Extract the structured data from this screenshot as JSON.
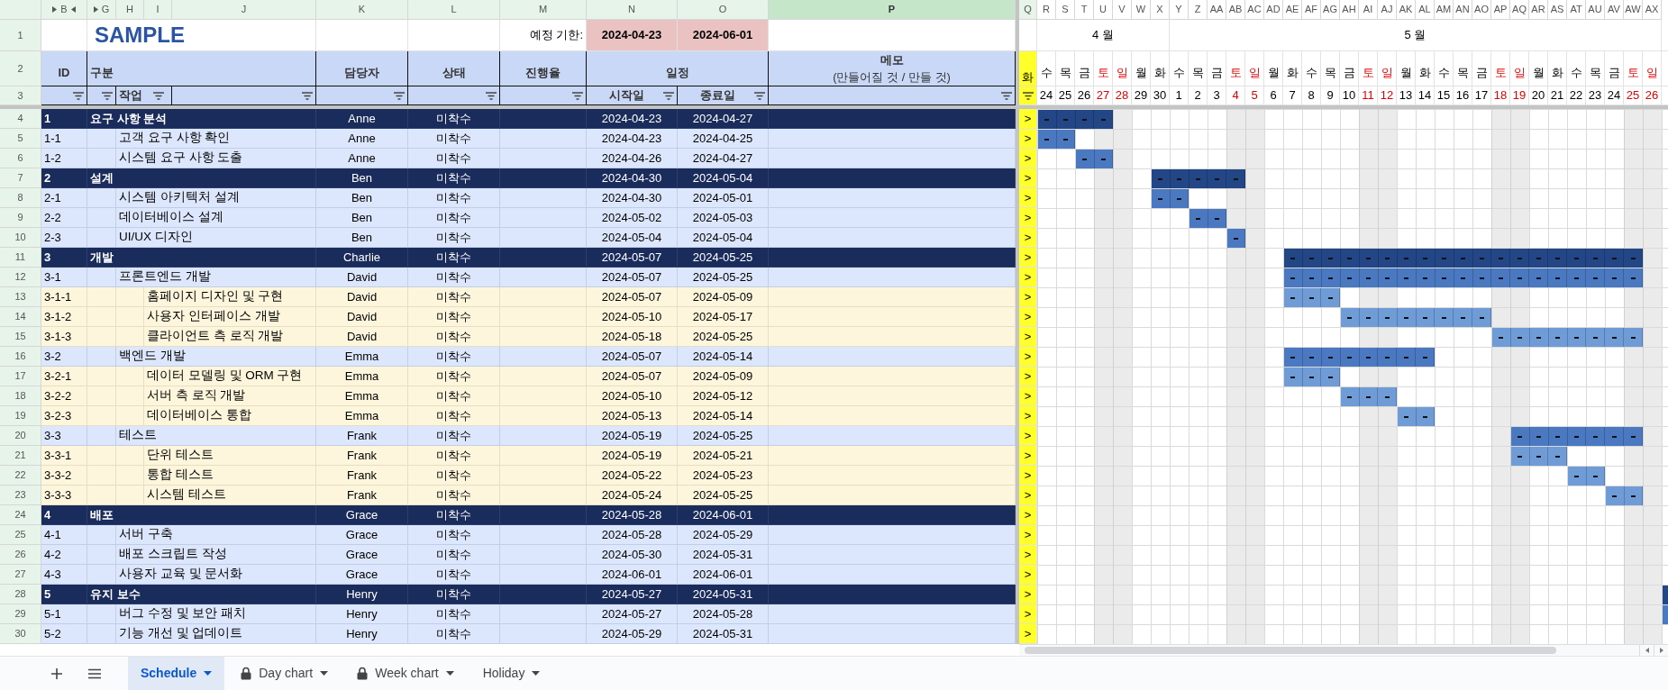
{
  "columns": [
    {
      "label": "B",
      "selected": true,
      "current": false,
      "hidden_before": true,
      "hidden_after": true
    },
    {
      "label": "G",
      "selected": true,
      "current": false,
      "hidden_before": true,
      "hidden_after": false
    },
    {
      "label": "H",
      "selected": true,
      "current": false,
      "hidden_before": false,
      "hidden_after": false
    },
    {
      "label": "I",
      "selected": true,
      "current": false,
      "hidden_before": false,
      "hidden_after": false
    },
    {
      "label": "J",
      "selected": true,
      "current": false,
      "hidden_before": false,
      "hidden_after": false
    },
    {
      "label": "K",
      "selected": true,
      "current": false,
      "hidden_before": false,
      "hidden_after": false
    },
    {
      "label": "L",
      "selected": true,
      "current": false,
      "hidden_before": false,
      "hidden_after": false
    },
    {
      "label": "M",
      "selected": true,
      "current": false,
      "hidden_before": false,
      "hidden_after": false
    },
    {
      "label": "N",
      "selected": true,
      "current": false,
      "hidden_before": false,
      "hidden_after": false
    },
    {
      "label": "O",
      "selected": true,
      "current": false,
      "hidden_before": false,
      "hidden_after": false
    },
    {
      "label": "P",
      "selected": true,
      "current": true,
      "hidden_before": false,
      "hidden_after": false
    },
    {
      "label": "Q",
      "selected": true,
      "current": false,
      "hidden_before": false,
      "hidden_after": false
    },
    {
      "label": "R",
      "selected": false,
      "current": false,
      "hidden_before": false,
      "hidden_after": false
    },
    {
      "label": "S",
      "selected": false,
      "current": false,
      "hidden_before": false,
      "hidden_after": false
    },
    {
      "label": "T",
      "selected": false,
      "current": false,
      "hidden_before": false,
      "hidden_after": false
    },
    {
      "label": "U",
      "selected": false,
      "current": false,
      "hidden_before": false,
      "hidden_after": false
    },
    {
      "label": "V",
      "selected": false,
      "current": false,
      "hidden_before": false,
      "hidden_after": false
    },
    {
      "label": "W",
      "selected": false,
      "current": false,
      "hidden_before": false,
      "hidden_after": false
    },
    {
      "label": "X",
      "selected": false,
      "current": false,
      "hidden_before": false,
      "hidden_after": false
    },
    {
      "label": "Y",
      "selected": false,
      "current": false,
      "hidden_before": false,
      "hidden_after": false
    },
    {
      "label": "Z",
      "selected": false,
      "current": false,
      "hidden_before": false,
      "hidden_after": false
    },
    {
      "label": "AA",
      "selected": false,
      "current": false,
      "hidden_before": false,
      "hidden_after": false
    },
    {
      "label": "AB",
      "selected": false,
      "current": false,
      "hidden_before": false,
      "hidden_after": false
    },
    {
      "label": "AC",
      "selected": false,
      "current": false,
      "hidden_before": false,
      "hidden_after": false
    },
    {
      "label": "AD",
      "selected": false,
      "current": false,
      "hidden_before": false,
      "hidden_after": false
    },
    {
      "label": "AE",
      "selected": false,
      "current": false,
      "hidden_before": false,
      "hidden_after": false
    },
    {
      "label": "AF",
      "selected": false,
      "current": false,
      "hidden_before": false,
      "hidden_after": false
    },
    {
      "label": "AG",
      "selected": false,
      "current": false,
      "hidden_before": false,
      "hidden_after": false
    },
    {
      "label": "AH",
      "selected": false,
      "current": false,
      "hidden_before": false,
      "hidden_after": false
    },
    {
      "label": "AI",
      "selected": false,
      "current": false,
      "hidden_before": false,
      "hidden_after": false
    },
    {
      "label": "AJ",
      "selected": false,
      "current": false,
      "hidden_before": false,
      "hidden_after": false
    },
    {
      "label": "AK",
      "selected": false,
      "current": false,
      "hidden_before": false,
      "hidden_after": false
    },
    {
      "label": "AL",
      "selected": false,
      "current": false,
      "hidden_before": false,
      "hidden_after": false
    },
    {
      "label": "AM",
      "selected": false,
      "current": false,
      "hidden_before": false,
      "hidden_after": false
    },
    {
      "label": "AN",
      "selected": false,
      "current": false,
      "hidden_before": false,
      "hidden_after": false
    },
    {
      "label": "AO",
      "selected": false,
      "current": false,
      "hidden_before": false,
      "hidden_after": false
    },
    {
      "label": "AP",
      "selected": false,
      "current": false,
      "hidden_before": false,
      "hidden_after": false
    },
    {
      "label": "AQ",
      "selected": false,
      "current": false,
      "hidden_before": false,
      "hidden_after": false
    },
    {
      "label": "AR",
      "selected": false,
      "current": false,
      "hidden_before": false,
      "hidden_after": false
    },
    {
      "label": "AS",
      "selected": false,
      "current": false,
      "hidden_before": false,
      "hidden_after": false
    },
    {
      "label": "AT",
      "selected": false,
      "current": false,
      "hidden_before": false,
      "hidden_after": false
    },
    {
      "label": "AU",
      "selected": false,
      "current": false,
      "hidden_before": false,
      "hidden_after": false
    },
    {
      "label": "AV",
      "selected": false,
      "current": false,
      "hidden_before": false,
      "hidden_after": false
    },
    {
      "label": "AW",
      "selected": false,
      "current": false,
      "hidden_before": false,
      "hidden_after": false
    },
    {
      "label": "AX",
      "selected": false,
      "current": false,
      "hidden_before": false,
      "hidden_after": false
    }
  ],
  "row_labels": [
    "1",
    "2",
    "3",
    "4",
    "5",
    "6",
    "7",
    "8",
    "9",
    "10",
    "11",
    "12",
    "13",
    "14",
    "15",
    "16",
    "17",
    "18",
    "19",
    "20",
    "21",
    "22",
    "23",
    "24",
    "25",
    "26",
    "27",
    "28",
    "29",
    "30"
  ],
  "title": "SAMPLE",
  "deadline": {
    "label": "예정 기한:",
    "start": "2024-04-23",
    "end": "2024-06-01"
  },
  "header": {
    "id": "ID",
    "group": "구분",
    "task": "작업",
    "assignee": "담당자",
    "status": "상태",
    "progress": "진행율",
    "schedule": "일정",
    "start": "시작일",
    "end": "종료일",
    "memo": "메모",
    "memo_note": "(만들어질 것 / 만들 것)"
  },
  "today": {
    "weekday": "화"
  },
  "months": [
    {
      "label": "4 월",
      "days": [
        {
          "weekday": "수",
          "date": "24",
          "weekend": false
        },
        {
          "weekday": "목",
          "date": "25",
          "weekend": false
        },
        {
          "weekday": "금",
          "date": "26",
          "weekend": false
        },
        {
          "weekday": "토",
          "date": "27",
          "weekend": true
        },
        {
          "weekday": "일",
          "date": "28",
          "weekend": true
        },
        {
          "weekday": "월",
          "date": "29",
          "weekend": false
        },
        {
          "weekday": "화",
          "date": "30",
          "weekend": false
        }
      ]
    },
    {
      "label": "5 월",
      "days": [
        {
          "weekday": "수",
          "date": "1",
          "weekend": false
        },
        {
          "weekday": "목",
          "date": "2",
          "weekend": false
        },
        {
          "weekday": "금",
          "date": "3",
          "weekend": false
        },
        {
          "weekday": "토",
          "date": "4",
          "weekend": true
        },
        {
          "weekday": "일",
          "date": "5",
          "weekend": true
        },
        {
          "weekday": "월",
          "date": "6",
          "weekend": false
        },
        {
          "weekday": "화",
          "date": "7",
          "weekend": false
        },
        {
          "weekday": "수",
          "date": "8",
          "weekend": false
        },
        {
          "weekday": "목",
          "date": "9",
          "weekend": false
        },
        {
          "weekday": "금",
          "date": "10",
          "weekend": false
        },
        {
          "weekday": "토",
          "date": "11",
          "weekend": true
        },
        {
          "weekday": "일",
          "date": "12",
          "weekend": true
        },
        {
          "weekday": "월",
          "date": "13",
          "weekend": false
        },
        {
          "weekday": "화",
          "date": "14",
          "weekend": false
        },
        {
          "weekday": "수",
          "date": "15",
          "weekend": false
        },
        {
          "weekday": "목",
          "date": "16",
          "weekend": false
        },
        {
          "weekday": "금",
          "date": "17",
          "weekend": false
        },
        {
          "weekday": "토",
          "date": "18",
          "weekend": true
        },
        {
          "weekday": "일",
          "date": "19",
          "weekend": true
        },
        {
          "weekday": "월",
          "date": "20",
          "weekend": false
        },
        {
          "weekday": "화",
          "date": "21",
          "weekend": false
        },
        {
          "weekday": "수",
          "date": "22",
          "weekend": false
        },
        {
          "weekday": "목",
          "date": "23",
          "weekend": false
        },
        {
          "weekday": "금",
          "date": "24",
          "weekend": false
        },
        {
          "weekday": "토",
          "date": "25",
          "weekend": true
        },
        {
          "weekday": "일",
          "date": "26",
          "weekend": true
        }
      ]
    }
  ],
  "rows": [
    {
      "kind": "phase",
      "id": "1",
      "task": "요구 사항 분석",
      "assignee": "Anne",
      "status": "미착수",
      "start": "2024-04-23",
      "end": "2024-04-27",
      "marker": ">"
    },
    {
      "kind": "task",
      "id": "1-1",
      "task": "고객 요구 사항 확인",
      "assignee": "Anne",
      "status": "미착수",
      "start": "2024-04-23",
      "end": "2024-04-25",
      "marker": ">"
    },
    {
      "kind": "task",
      "id": "1-2",
      "task": "시스템 요구 사항 도출",
      "assignee": "Anne",
      "status": "미착수",
      "start": "2024-04-26",
      "end": "2024-04-27",
      "marker": ">"
    },
    {
      "kind": "phase",
      "id": "2",
      "task": "설계",
      "assignee": "Ben",
      "status": "미착수",
      "start": "2024-04-30",
      "end": "2024-05-04",
      "marker": ">"
    },
    {
      "kind": "task",
      "id": "2-1",
      "task": "시스템 아키텍처 설계",
      "assignee": "Ben",
      "status": "미착수",
      "start": "2024-04-30",
      "end": "2024-05-01",
      "marker": ">"
    },
    {
      "kind": "task",
      "id": "2-2",
      "task": "데이터베이스 설계",
      "assignee": "Ben",
      "status": "미착수",
      "start": "2024-05-02",
      "end": "2024-05-03",
      "marker": ">"
    },
    {
      "kind": "task",
      "id": "2-3",
      "task": "UI/UX 디자인",
      "assignee": "Ben",
      "status": "미착수",
      "start": "2024-05-04",
      "end": "2024-05-04",
      "marker": ">"
    },
    {
      "kind": "phase",
      "id": "3",
      "task": "개발",
      "assignee": "Charlie",
      "status": "미착수",
      "start": "2024-05-07",
      "end": "2024-05-25",
      "marker": ">"
    },
    {
      "kind": "task",
      "id": "3-1",
      "task": "프론트엔드 개발",
      "assignee": "David",
      "status": "미착수",
      "start": "2024-05-07",
      "end": "2024-05-25",
      "marker": ">"
    },
    {
      "kind": "subtask",
      "id": "3-1-1",
      "task": "홈페이지 디자인 및 구현",
      "assignee": "David",
      "status": "미착수",
      "start": "2024-05-07",
      "end": "2024-05-09",
      "marker": ">"
    },
    {
      "kind": "subtask",
      "id": "3-1-2",
      "task": "사용자 인터페이스 개발",
      "assignee": "David",
      "status": "미착수",
      "start": "2024-05-10",
      "end": "2024-05-17",
      "marker": ">"
    },
    {
      "kind": "subtask",
      "id": "3-1-3",
      "task": "클라이언트 측 로직 개발",
      "assignee": "David",
      "status": "미착수",
      "start": "2024-05-18",
      "end": "2024-05-25",
      "marker": ">"
    },
    {
      "kind": "task",
      "id": "3-2",
      "task": "백엔드 개발",
      "assignee": "Emma",
      "status": "미착수",
      "start": "2024-05-07",
      "end": "2024-05-14",
      "marker": ">"
    },
    {
      "kind": "subtask",
      "id": "3-2-1",
      "task": "데이터 모델링 및 ORM 구현",
      "assignee": "Emma",
      "status": "미착수",
      "start": "2024-05-07",
      "end": "2024-05-09",
      "marker": ">"
    },
    {
      "kind": "subtask",
      "id": "3-2-2",
      "task": "서버 측 로직 개발",
      "assignee": "Emma",
      "status": "미착수",
      "start": "2024-05-10",
      "end": "2024-05-12",
      "marker": ">"
    },
    {
      "kind": "subtask",
      "id": "3-2-3",
      "task": "데이터베이스 통합",
      "assignee": "Emma",
      "status": "미착수",
      "start": "2024-05-13",
      "end": "2024-05-14",
      "marker": ">"
    },
    {
      "kind": "task",
      "id": "3-3",
      "task": "테스트",
      "assignee": "Frank",
      "status": "미착수",
      "start": "2024-05-19",
      "end": "2024-05-25",
      "marker": ">"
    },
    {
      "kind": "subtask",
      "id": "3-3-1",
      "task": "단위 테스트",
      "assignee": "Frank",
      "status": "미착수",
      "start": "2024-05-19",
      "end": "2024-05-21",
      "marker": ">"
    },
    {
      "kind": "subtask",
      "id": "3-3-2",
      "task": "통합 테스트",
      "assignee": "Frank",
      "status": "미착수",
      "start": "2024-05-22",
      "end": "2024-05-23",
      "marker": ">"
    },
    {
      "kind": "subtask",
      "id": "3-3-3",
      "task": "시스템 테스트",
      "assignee": "Frank",
      "status": "미착수",
      "start": "2024-05-24",
      "end": "2024-05-25",
      "marker": ">"
    },
    {
      "kind": "phase",
      "id": "4",
      "task": "배포",
      "assignee": "Grace",
      "status": "미착수",
      "start": "2024-05-28",
      "end": "2024-06-01",
      "marker": ">"
    },
    {
      "kind": "task",
      "id": "4-1",
      "task": "서버 구축",
      "assignee": "Grace",
      "status": "미착수",
      "start": "2024-05-28",
      "end": "2024-05-29",
      "marker": ">"
    },
    {
      "kind": "task",
      "id": "4-2",
      "task": "배포 스크립트 작성",
      "assignee": "Grace",
      "status": "미착수",
      "start": "2024-05-30",
      "end": "2024-05-31",
      "marker": ">"
    },
    {
      "kind": "task",
      "id": "4-3",
      "task": "사용자 교육 및 문서화",
      "assignee": "Grace",
      "status": "미착수",
      "start": "2024-06-01",
      "end": "2024-06-01",
      "marker": ">"
    },
    {
      "kind": "phase",
      "id": "5",
      "task": "유지 보수",
      "assignee": "Henry",
      "status": "미착수",
      "start": "2024-05-27",
      "end": "2024-05-31",
      "marker": ">"
    },
    {
      "kind": "task",
      "id": "5-1",
      "task": "버그 수정 및 보안 패치",
      "assignee": "Henry",
      "status": "미착수",
      "start": "2024-05-27",
      "end": "2024-05-28",
      "marker": ">"
    },
    {
      "kind": "task",
      "id": "5-2",
      "task": "기능 개선 및 업데이트",
      "assignee": "Henry",
      "status": "미착수",
      "start": "2024-05-29",
      "end": "2024-05-31",
      "marker": ">"
    }
  ],
  "sheet_tabs": [
    {
      "label": "Schedule",
      "selected": true,
      "locked": false
    },
    {
      "label": "Day chart",
      "selected": false,
      "locked": true
    },
    {
      "label": "Week chart",
      "selected": false,
      "locked": true
    },
    {
      "label": "Holiday",
      "selected": false,
      "locked": false
    }
  ]
}
